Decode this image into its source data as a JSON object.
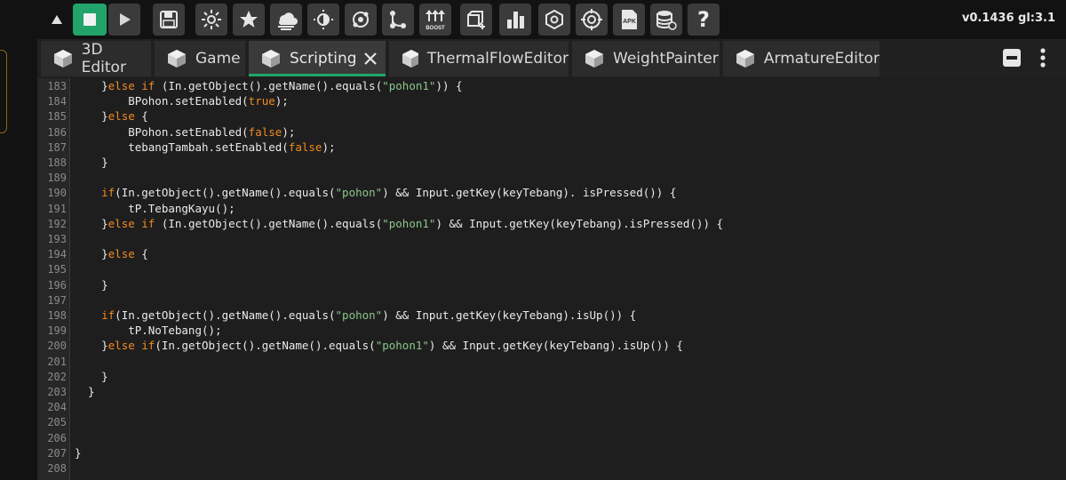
{
  "toolbar": {
    "version": "v0.1436 gl:3.1",
    "apk_label": "APK",
    "boost_label": "BOOST",
    "help_glyph": "?"
  },
  "tabs": [
    {
      "label": "3D Editor"
    },
    {
      "label": "Game"
    },
    {
      "label": "Scripting",
      "active": true
    },
    {
      "label": "ThermalFlowEditor"
    },
    {
      "label": "WeightPainter"
    },
    {
      "label": "ArmatureEditor"
    }
  ],
  "editor": {
    "lines": [
      {
        "n": "183",
        "code": "    }else if (In.getObject().getName().equals(\"pohon1\")) {"
      },
      {
        "n": "184",
        "code": "        BPohon.setEnabled(true);"
      },
      {
        "n": "185",
        "code": "    }else {"
      },
      {
        "n": "186",
        "code": "        BPohon.setEnabled(false);"
      },
      {
        "n": "187",
        "code": "        tebangTambah.setEnabled(false);"
      },
      {
        "n": "188",
        "code": "    }"
      },
      {
        "n": "189",
        "code": ""
      },
      {
        "n": "190",
        "code": "    if(In.getObject().getName().equals(\"pohon\") && Input.getKey(keyTebang). isPressed()) {"
      },
      {
        "n": "191",
        "code": "        tP.TebangKayu();"
      },
      {
        "n": "192",
        "code": "    }else if (In.getObject().getName().equals(\"pohon1\") && Input.getKey(keyTebang).isPressed()) {"
      },
      {
        "n": "193",
        "code": ""
      },
      {
        "n": "194",
        "code": "    }else {"
      },
      {
        "n": "195",
        "code": ""
      },
      {
        "n": "196",
        "code": "    }"
      },
      {
        "n": "197",
        "code": ""
      },
      {
        "n": "198",
        "code": "    if(In.getObject().getName().equals(\"pohon\") && Input.getKey(keyTebang).isUp()) {"
      },
      {
        "n": "199",
        "code": "        tP.NoTebang();"
      },
      {
        "n": "200",
        "code": "    }else if(In.getObject().getName().equals(\"pohon1\") && Input.getKey(keyTebang).isUp()) {"
      },
      {
        "n": "201",
        "code": ""
      },
      {
        "n": "202",
        "code": "    }"
      },
      {
        "n": "203",
        "code": "  }"
      },
      {
        "n": "204",
        "code": ""
      },
      {
        "n": "205",
        "code": ""
      },
      {
        "n": "206",
        "code": ""
      },
      {
        "n": "207",
        "code": "}"
      },
      {
        "n": "208",
        "code": ""
      }
    ]
  }
}
